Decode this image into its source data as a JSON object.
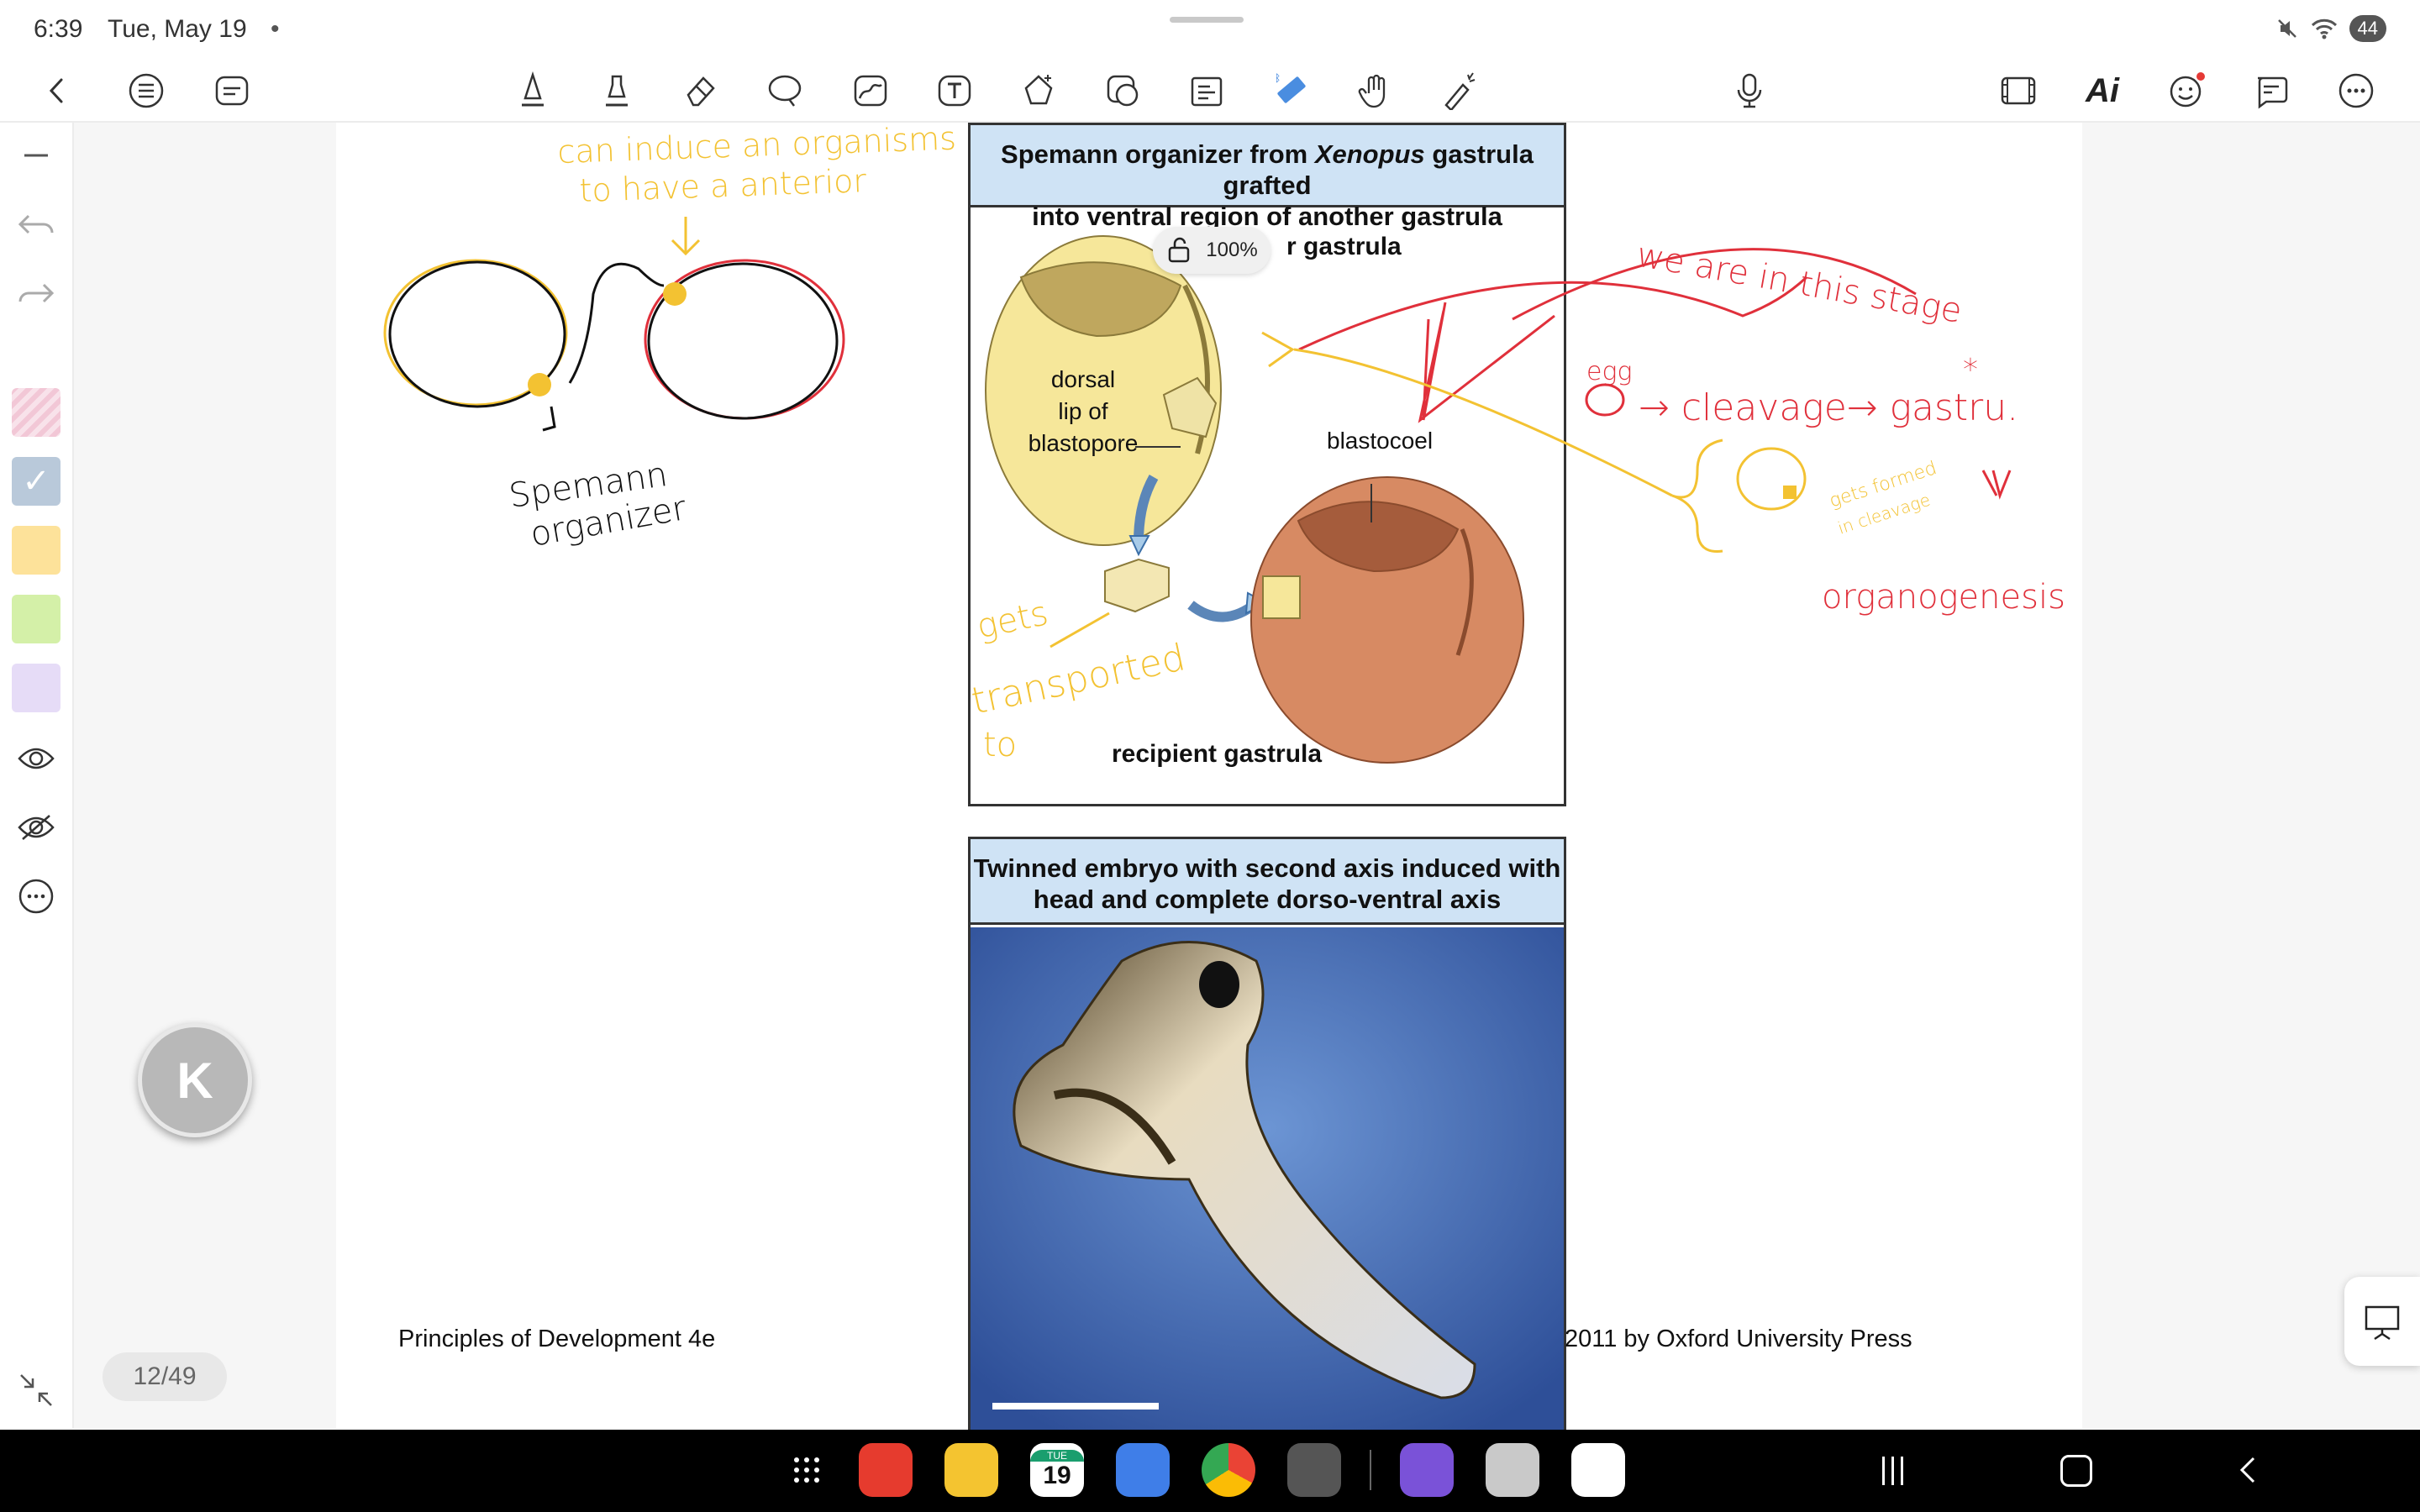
{
  "status": {
    "time": "6:39",
    "date": "Tue, May 19",
    "dot": "•",
    "battery": "44"
  },
  "toolbar": {
    "left": [
      "back-icon",
      "outline-list-icon",
      "page-layout-icon"
    ],
    "tools": [
      "pen-icon",
      "highlighter-icon",
      "eraser-icon",
      "lasso-icon",
      "image-icon",
      "text-tool-icon",
      "shapes-icon",
      "sticker-icon",
      "textbox-icon",
      "ruler-icon",
      "hand-icon",
      "laser-pointer-icon"
    ],
    "mic": "microphone-icon",
    "right": [
      "slides-icon",
      "ai-icon",
      "sticker-emoji-icon",
      "comments-icon",
      "more-icon"
    ],
    "ai_label": "Ai"
  },
  "rail": {
    "colors": [
      "#f2c7d6",
      "#b9c9da",
      "#fde29a",
      "#d4f0a8",
      "#e6dcf7"
    ]
  },
  "canvas": {
    "figure1": {
      "title_pre": "Spemann organizer from ",
      "title_em": "Xenopus",
      "title_post": " gastrula grafted",
      "title_line2": "into ventral region of another gastrula",
      "donor_label": "r gastrula",
      "dorsal_label_1": "dorsal",
      "dorsal_label_2": "lip of",
      "dorsal_label_3": "blastopore",
      "blastocoel_label": "blastocoel",
      "recipient_label": "recipient gastrula"
    },
    "figure2": {
      "title_line1": "Twinned embryo with second axis induced with",
      "title_line2": "head and complete dorso-ventral axis"
    },
    "footer_left": "Principles of Development 4e",
    "footer_right": "2011 by Oxford University Press",
    "zoom": "100%",
    "ink": {
      "yellow_1": "can induce an organisms",
      "yellow_2": "to have a anterior",
      "black_1": "Spemann",
      "black_2": "organizer",
      "gets": "gets",
      "transported": "transported",
      "to": "to",
      "red_stage": "we are in this stage",
      "red_egg": "egg",
      "red_cleavage": "→ cleavage→ gastru.",
      "red_organo": "organogenesis",
      "yellow_formed_1": "gets formed",
      "yellow_formed_2": "in cleavage"
    }
  },
  "page_counter": "12/49",
  "k_button": "K",
  "colors": {
    "red_ink": "#e0303b",
    "yellow_ink": "#f3c232",
    "header_blue": "#cfe3f5"
  },
  "dock": {
    "calendar_day": "TUE",
    "calendar_num": "19"
  }
}
